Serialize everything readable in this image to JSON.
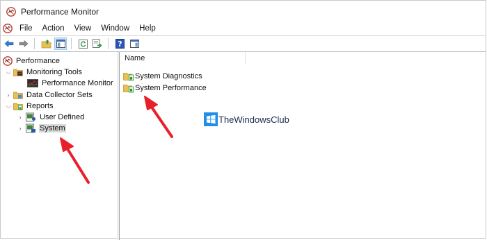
{
  "window": {
    "title": "Performance Monitor"
  },
  "menu": {
    "items": [
      "File",
      "Action",
      "View",
      "Window",
      "Help"
    ]
  },
  "toolbar": {
    "buttons": [
      "back-icon",
      "forward-icon",
      "up-folder-icon",
      "show-hide-tree-icon",
      "refresh-icon",
      "export-list-icon",
      "help-icon",
      "show-hide-action-pane-icon"
    ]
  },
  "tree": {
    "root": "Performance",
    "monitoring_tools": "Monitoring Tools",
    "performance_monitor": "Performance Monitor",
    "data_collector_sets": "Data Collector Sets",
    "reports": "Reports",
    "user_defined": "User Defined",
    "system": "System"
  },
  "list": {
    "column_name": "Name",
    "items": [
      "System Diagnostics",
      "System Performance"
    ]
  },
  "watermark": {
    "text": "TheWindowsClub"
  },
  "colors": {
    "accent": "#e8202a",
    "selection": "#d9d9d9",
    "folder": "#e9c153"
  }
}
